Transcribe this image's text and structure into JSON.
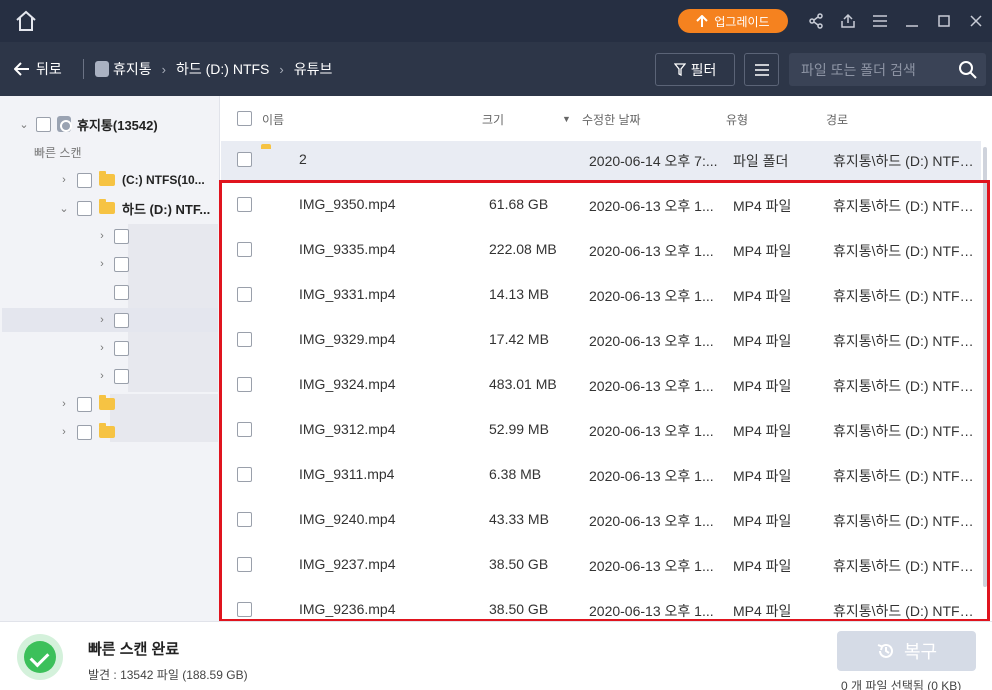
{
  "titlebar": {
    "upgrade_label": "업그레이드"
  },
  "nav": {
    "back_label": "뒤로",
    "breadcrumb": [
      "휴지통",
      "하드 (D:) NTFS",
      "유튜브"
    ],
    "filter_label": "필터",
    "search_placeholder": "파일 또는 폴더 검색"
  },
  "sidebar": {
    "root_label": "휴지통(13542)",
    "quick_scan_label": "빠른 스캔",
    "drives": [
      {
        "label": "(C:) NTFS(10..."
      },
      {
        "label": "하드 (D:) NTF..."
      }
    ]
  },
  "table": {
    "headers": {
      "name": "이름",
      "size": "크기",
      "modified": "수정한 날짜",
      "type": "유형",
      "path": "경로"
    },
    "rows": [
      {
        "name": "2",
        "size": "",
        "date": "2020-06-14 오후 7:...",
        "type": "파일 폴더",
        "path": "휴지통\\하드 (D:) NTFS...",
        "icon": "folder"
      },
      {
        "name": "IMG_9350.mp4",
        "size": "61.68 GB",
        "date": "2020-06-13 오후 1...",
        "type": "MP4 파일",
        "path": "휴지통\\하드 (D:) NTFS...",
        "icon": "video"
      },
      {
        "name": "IMG_9335.mp4",
        "size": "222.08 MB",
        "date": "2020-06-13 오후 1...",
        "type": "MP4 파일",
        "path": "휴지통\\하드 (D:) NTFS...",
        "icon": "video"
      },
      {
        "name": "IMG_9331.mp4",
        "size": "14.13 MB",
        "date": "2020-06-13 오후 1...",
        "type": "MP4 파일",
        "path": "휴지통\\하드 (D:) NTFS...",
        "icon": "video"
      },
      {
        "name": "IMG_9329.mp4",
        "size": "17.42 MB",
        "date": "2020-06-13 오후 1...",
        "type": "MP4 파일",
        "path": "휴지통\\하드 (D:) NTFS...",
        "icon": "video"
      },
      {
        "name": "IMG_9324.mp4",
        "size": "483.01 MB",
        "date": "2020-06-13 오후 1...",
        "type": "MP4 파일",
        "path": "휴지통\\하드 (D:) NTFS...",
        "icon": "video"
      },
      {
        "name": "IMG_9312.mp4",
        "size": "52.99 MB",
        "date": "2020-06-13 오후 1...",
        "type": "MP4 파일",
        "path": "휴지통\\하드 (D:) NTFS...",
        "icon": "video"
      },
      {
        "name": "IMG_9311.mp4",
        "size": "6.38 MB",
        "date": "2020-06-13 오후 1...",
        "type": "MP4 파일",
        "path": "휴지통\\하드 (D:) NTFS...",
        "icon": "video"
      },
      {
        "name": "IMG_9240.mp4",
        "size": "43.33 MB",
        "date": "2020-06-13 오후 1...",
        "type": "MP4 파일",
        "path": "휴지통\\하드 (D:) NTFS...",
        "icon": "video"
      },
      {
        "name": "IMG_9237.mp4",
        "size": "38.50 GB",
        "date": "2020-06-13 오후 1...",
        "type": "MP4 파일",
        "path": "휴지통\\하드 (D:) NTFS...",
        "icon": "video"
      },
      {
        "name": "IMG_9236.mp4",
        "size": "38.50 GB",
        "date": "2020-06-13 오후 1...",
        "type": "MP4 파일",
        "path": "휴지통\\하드 (D:) NTFS...",
        "icon": "video"
      }
    ]
  },
  "footer": {
    "scan_title": "빠른 스캔 완료",
    "scan_detail": "발견 : 13542 파일 (188.59 GB)",
    "recover_label": "복구",
    "selected_info": "0 개 파일 선택됨 (0 KB)"
  },
  "colors": {
    "titlebar_bg": "#262f42",
    "navbar_bg": "#2d3648",
    "upgrade_accent": "#f5821f",
    "highlight_frame": "#e0141e",
    "video_icon": "#2f7fe4",
    "folder_icon": "#f6c343",
    "success": "#3cc05a"
  }
}
